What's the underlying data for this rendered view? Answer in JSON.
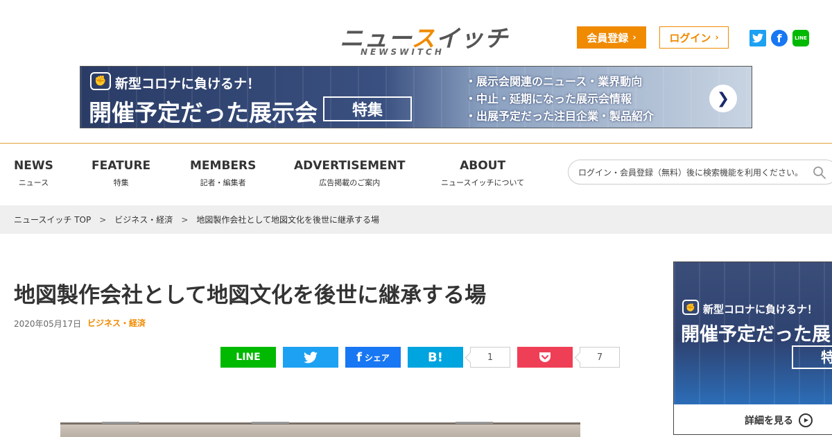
{
  "header": {
    "logo_main_pre": "ニュー",
    "logo_main_accent": "ス",
    "logo_main_post": "イッチ",
    "logo_sub": "NEWSWITCH",
    "register_label": "会員登録",
    "login_label": "ログイン",
    "chevron": "›",
    "sns": {
      "twitter_glyph": "🐦",
      "facebook_glyph": "f",
      "line_glyph": "LINE"
    }
  },
  "banner": {
    "sub": "新型コロナに負けるナ！",
    "main": "開催予定だった展示会",
    "tag": "特集",
    "list": [
      "・展示会関連のニュース・業界動向",
      "・中止・延期になった展示会情報",
      "・出展予定だった注目企業・製品紹介"
    ],
    "arrow": "❯"
  },
  "nav": {
    "items": [
      {
        "en": "NEWS",
        "jp": "ニュース"
      },
      {
        "en": "FEATURE",
        "jp": "特集"
      },
      {
        "en": "MEMBERS",
        "jp": "記者・編集者"
      },
      {
        "en": "ADVERTISEMENT",
        "jp": "広告掲載のご案内"
      },
      {
        "en": "ABOUT",
        "jp": "ニュースイッチについて"
      }
    ],
    "search_placeholder": "ログイン・会員登録（無料）後に検索機能を利用ください。"
  },
  "breadcrumb": {
    "items": [
      "ニュースイッチ TOP",
      "ビジネス・経済",
      "地図製作会社として地図文化を後世に継承する場"
    ],
    "separator": ">"
  },
  "article": {
    "title": "地図製作会社として地図文化を後世に継承する場",
    "date": "2020年05月17日",
    "category": "ビジネス・経済"
  },
  "share": {
    "line_label": "LINE",
    "twitter_glyph": "🐦",
    "facebook_f": "f",
    "facebook_label": "シェア",
    "hatena_label": "B!",
    "hatena_count": "1",
    "pocket_count": "7"
  },
  "side_ad": {
    "sub": "新型コロナに負けるナ！",
    "main": "開催予定だった展",
    "tag": "特",
    "more_label": "詳細を見る"
  },
  "colors": {
    "accent": "#f08a00",
    "line": "#00b900",
    "twitter": "#1da1f2",
    "facebook": "#1877f2",
    "hatena": "#00a4de",
    "pocket": "#ef3f56"
  }
}
